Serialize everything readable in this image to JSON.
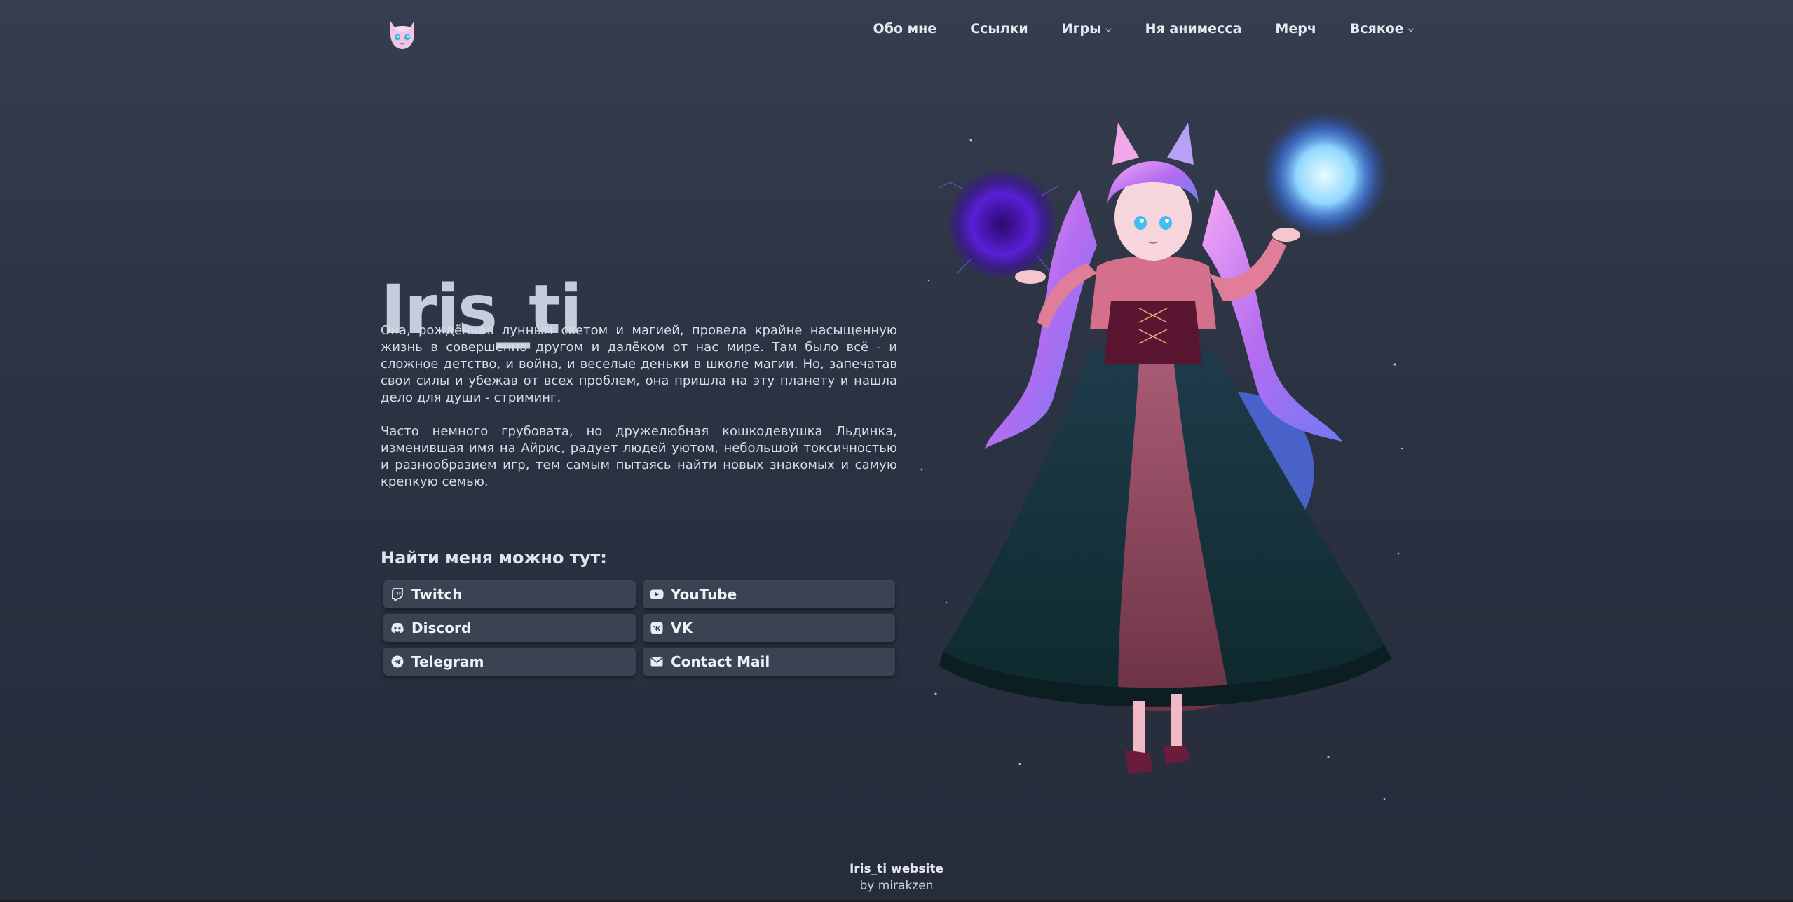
{
  "nav": {
    "items": [
      {
        "label": "Обо мне",
        "dropdown": false
      },
      {
        "label": "Ссылки",
        "dropdown": false
      },
      {
        "label": "Игры",
        "dropdown": true
      },
      {
        "label": "Ня анимесса",
        "dropdown": false
      },
      {
        "label": "Мерч",
        "dropdown": false
      },
      {
        "label": "Всякое",
        "dropdown": true
      }
    ]
  },
  "hero": {
    "title": "Iris_ti",
    "paragraphs": [
      "Она, рождённая лунным светом и магией, провела крайне насыщенную жизнь в совершенно другом и далёком от нас мире. Там было всё - и сложное детство, и война, и веселые деньки в школе магии. Но, запечатав свои силы и убежав от всех проблем, она пришла на эту планету и нашла дело для души - стриминг.",
      "Часто немного грубовата, но дружелюбная кошкодевушка Льдинка, изменившая имя на Айрис, радует людей уютом, небольшой токсичностью и разнообразием игр, тем самым пытаясь найти новых знакомых и самую крепкую семью."
    ]
  },
  "links": {
    "heading": "Найти меня можно тут:",
    "items": [
      {
        "label": "Twitch",
        "icon": "twitch-icon"
      },
      {
        "label": "YouTube",
        "icon": "youtube-icon"
      },
      {
        "label": "Discord",
        "icon": "discord-icon"
      },
      {
        "label": "VK",
        "icon": "vk-icon"
      },
      {
        "label": "Telegram",
        "icon": "telegram-icon"
      },
      {
        "label": "Contact Mail",
        "icon": "mail-icon"
      }
    ]
  },
  "footer": {
    "site": "Iris_ti website",
    "author": "by mirakzen"
  },
  "colors": {
    "background_top": "#353e4f",
    "background_bottom": "#262c3a",
    "button_bg": "#3b4353",
    "title": "#c5cddc",
    "orb_dark": "#5a1fd6",
    "orb_light": "#8fd8ff"
  }
}
